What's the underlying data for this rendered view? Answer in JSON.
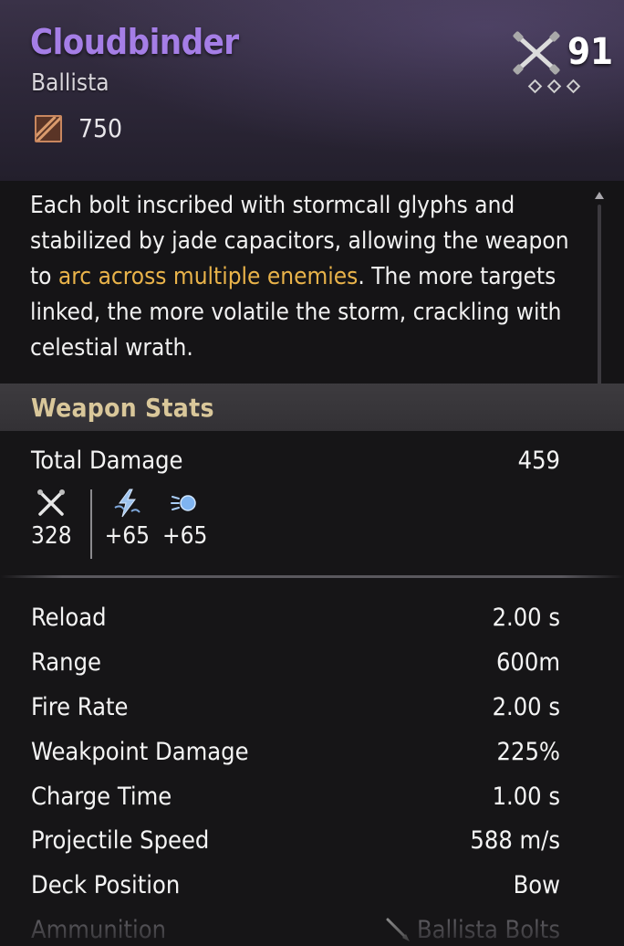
{
  "item": {
    "name": "Cloudbinder",
    "type": "Ballista",
    "cost": "750",
    "level": "91",
    "rank_total": 3,
    "rank_filled": 0
  },
  "description": {
    "part1": "Each bolt inscribed with stormcall glyphs and stabilized by jade capacitors, allowing the weapon to ",
    "highlight": "arc across multiple enemies",
    "part2": ". The more targets linked, the more volatile the storm, crackling with celestial wrath."
  },
  "stats_section": {
    "title": "Weapon Stats",
    "total_damage": {
      "label": "Total Damage",
      "value": "459"
    },
    "damage_breakdown": [
      {
        "icon": "crossed-bolts-icon",
        "value": "328"
      },
      {
        "icon": "lightning-icon",
        "value": "+65"
      },
      {
        "icon": "frost-orb-icon",
        "value": "+65"
      }
    ],
    "rows": [
      {
        "label": "Reload",
        "value": "2.00 s"
      },
      {
        "label": "Range",
        "value": "600m"
      },
      {
        "label": "Fire Rate",
        "value": "2.00 s"
      },
      {
        "label": "Weakpoint Damage",
        "value": "225%"
      },
      {
        "label": "Charge Time",
        "value": "1.00 s"
      },
      {
        "label": "Projectile Speed",
        "value": "588 m/s"
      },
      {
        "label": "Deck Position",
        "value": "Bow"
      }
    ],
    "ammunition": {
      "label": "Ammunition",
      "value": "Ballista Bolts",
      "icon": "bolt-icon"
    }
  },
  "colors": {
    "title": "#a57ee6",
    "highlight": "#e9b34a",
    "section_title": "#d9c79a",
    "cost_icon": "#c9875f"
  }
}
